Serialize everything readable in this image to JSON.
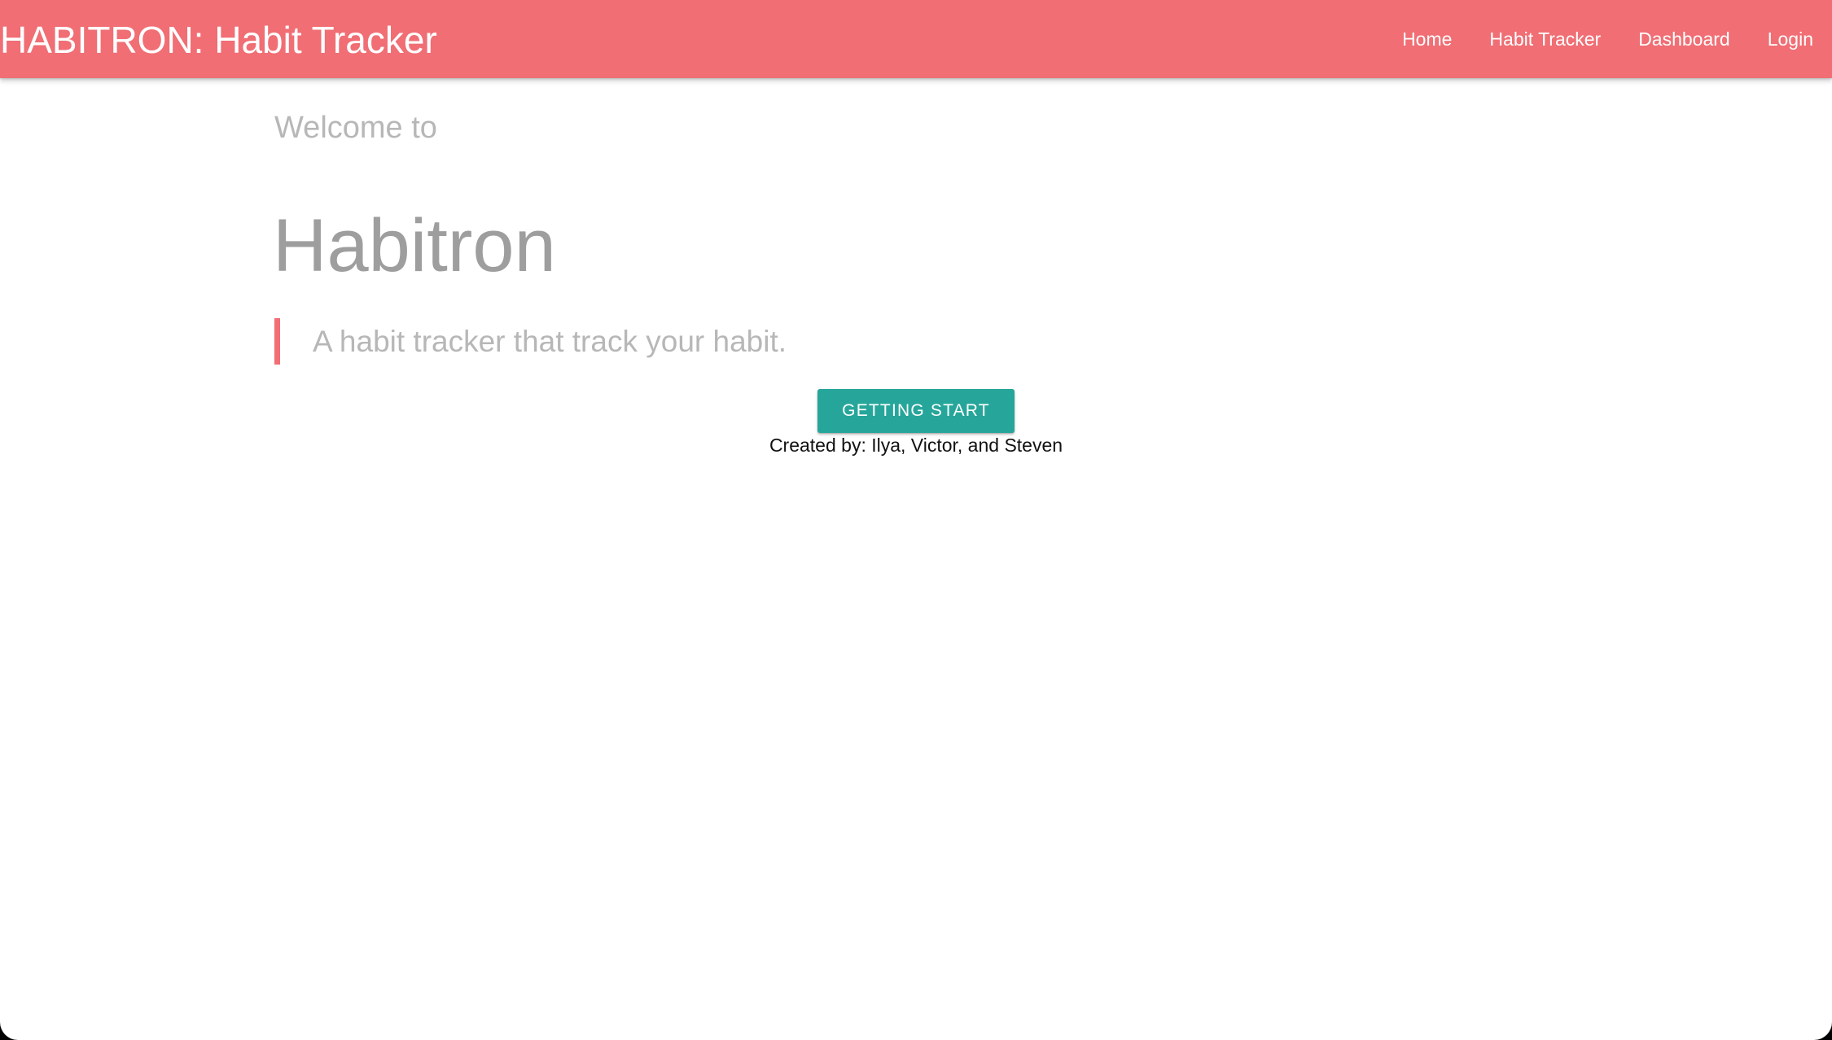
{
  "navbar": {
    "brand": "HABITRON: Habit Tracker",
    "links": [
      {
        "label": "Home"
      },
      {
        "label": "Habit Tracker"
      },
      {
        "label": "Dashboard"
      },
      {
        "label": "Login"
      }
    ]
  },
  "hero": {
    "welcome": "Welcome to",
    "title": "Habitron",
    "tagline": "A habit tracker that track your habit.",
    "cta_label": "GETTING START",
    "credits": "Created by: Ilya, Victor, and Steven"
  },
  "colors": {
    "navbar_bg": "#f06e74",
    "button_bg": "#26a69a",
    "title_text": "#9e9e9e",
    "muted_text": "#b7b7b7"
  }
}
